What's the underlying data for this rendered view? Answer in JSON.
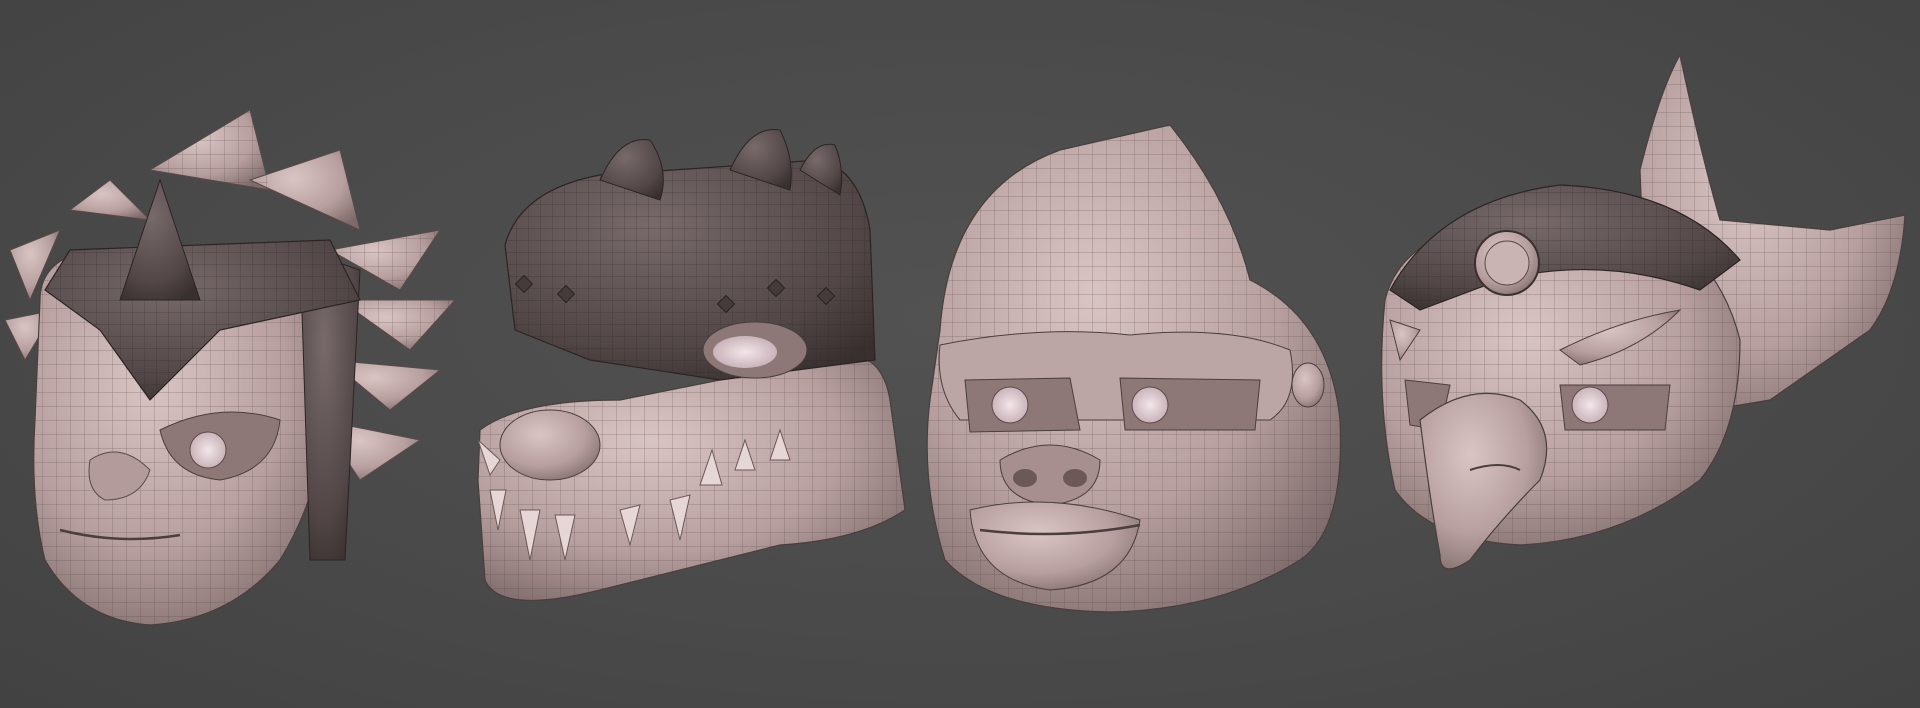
{
  "scene": {
    "background": "#494949",
    "skin_color": "#c6b0b0",
    "helmet_color": "#5e5252",
    "wireframe_color": "#4a3e3e",
    "masks": [
      {
        "subject": "lion",
        "icon": "lion-mask-icon"
      },
      {
        "subject": "crocodile",
        "icon": "crocodile-mask-icon"
      },
      {
        "subject": "gorilla",
        "icon": "gorilla-mask-icon"
      },
      {
        "subject": "eagle",
        "icon": "eagle-mask-icon"
      }
    ]
  }
}
